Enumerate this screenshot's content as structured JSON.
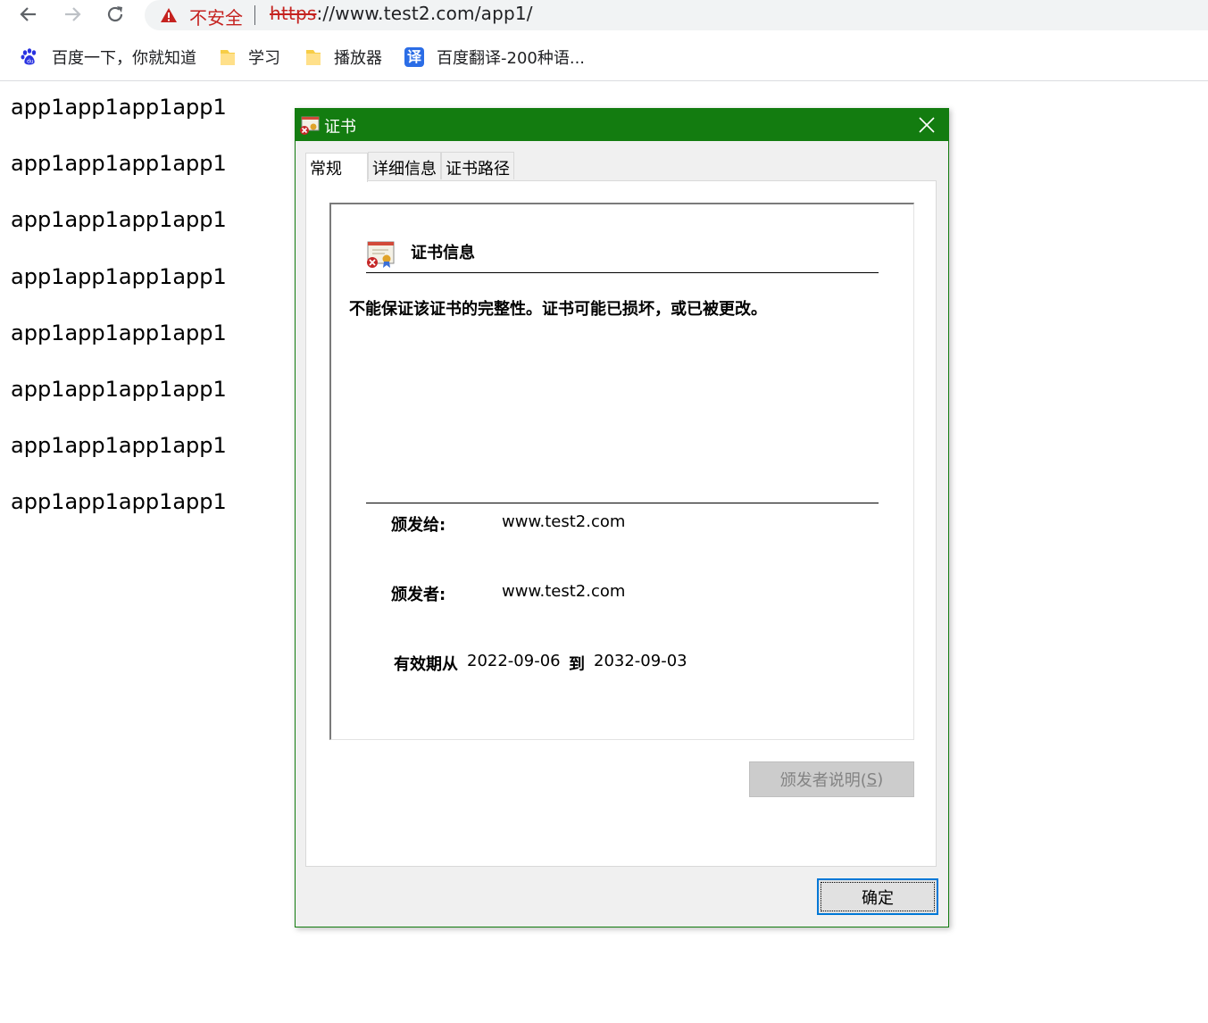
{
  "browser": {
    "security_label": "不安全",
    "url_scheme": "https",
    "url_rest": "://www.test2.com/app1/",
    "bookmarks": [
      {
        "label": "百度一下，你就知道",
        "icon": "baidu-paw-icon"
      },
      {
        "label": "学习",
        "icon": "folder-icon"
      },
      {
        "label": "播放器",
        "icon": "folder-icon"
      },
      {
        "label": "百度翻译-200种语...",
        "icon": "translate-icon",
        "icon_text": "译"
      }
    ]
  },
  "page": {
    "lines": [
      "app1app1app1app1",
      "app1app1app1app1",
      "app1app1app1app1",
      "app1app1app1app1",
      "app1app1app1app1",
      "app1app1app1app1",
      "app1app1app1app1",
      "app1app1app1app1"
    ]
  },
  "dialog": {
    "title": "证书",
    "tabs": [
      {
        "label": "常规",
        "active": true
      },
      {
        "label": "详细信息",
        "active": false
      },
      {
        "label": "证书路径",
        "active": false
      }
    ],
    "info_title": "证书信息",
    "warning": "不能保证该证书的完整性。证书可能已损坏，或已被更改。",
    "issued_to_label": "颁发给:",
    "issued_to_value": "www.test2.com",
    "issued_by_label": "颁发者:",
    "issued_by_value": "www.test2.com",
    "valid_from_label": "有效期从",
    "valid_from_value": "2022-09-06",
    "valid_to_label": "到",
    "valid_to_value": "2032-09-03",
    "issuer_statement_button": "颁发者说明(",
    "issuer_statement_key": "S",
    "issuer_statement_tail": ")",
    "ok_button": "确定"
  },
  "colors": {
    "titlebar": "#137c10",
    "warning_red": "#c5221f",
    "focus_blue": "#0078d7"
  }
}
